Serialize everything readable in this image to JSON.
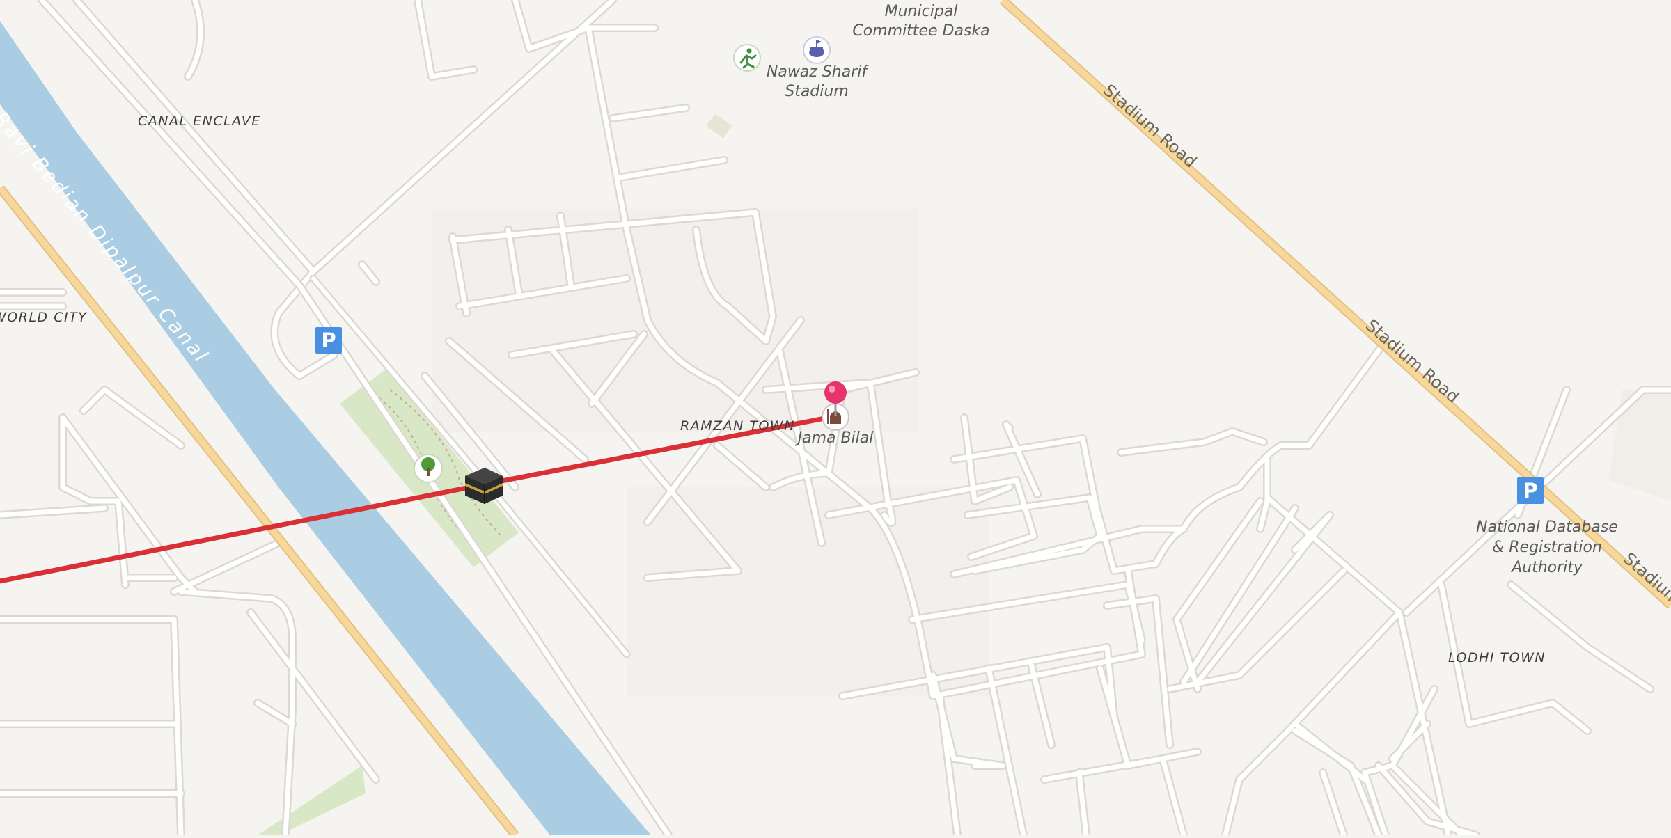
{
  "map": {
    "labels": {
      "canal_enclave": "CANAL ENCLAVE",
      "world_city": "WORLD CITY",
      "ramzan_town": "RAMZAN TOWN",
      "lodhi_town": "LODHI TOWN",
      "canal": "Marala Ravi Bedian Dipalpur Canal",
      "municipal_1": "Municipal",
      "municipal_2": "Committee Daska",
      "stadium_1": "Nawaz Sharif",
      "stadium_2": "Stadium",
      "jama_bilal": "Jama Bilal",
      "stadium_road": "Stadium Road",
      "nadra_1": "National Database",
      "nadra_2": "& Registration",
      "nadra_3": "Authority",
      "parking_symbol": "P"
    },
    "icons": [
      "parking-icon",
      "tree-icon",
      "kaaba-icon",
      "mosque-icon",
      "location-pin-icon",
      "sports-icon",
      "stadium-icon"
    ],
    "colors": {
      "background": "#f6f4f1",
      "water": "#aacde3",
      "park": "#d8e8c6",
      "route": "#d93035",
      "pin": "#e8336f",
      "parking": "#4a90e2",
      "arterial_road": "#f7d79b"
    }
  }
}
